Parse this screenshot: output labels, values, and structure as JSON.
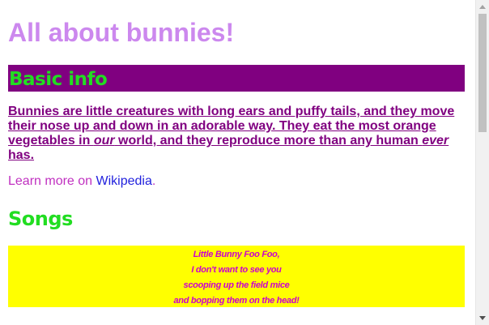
{
  "page": {
    "title": "All about bunnies!"
  },
  "basic_info": {
    "heading": "Basic info",
    "intro_part1": "Bunnies are little creatures with long ears and puffy tails, and they move their nose up and down in an adorable way. They eat the most orange vegetables in ",
    "intro_em1": "our",
    "intro_part2": " world, and they reproduce more than any human ",
    "intro_em2": "ever",
    "intro_part3": " has.",
    "learn_more_prefix": "Learn more on ",
    "learn_more_link": "Wikipedia",
    "learn_more_suffix": "."
  },
  "songs": {
    "heading": "Songs",
    "lines": [
      "Little Bunny Foo Foo,",
      "I don't want to see you",
      "scooping up the field mice",
      "and bopping them on the head!"
    ]
  },
  "colors": {
    "title": "#cc88ee",
    "heading_bar": "#800080",
    "heading_text": "#22dd22",
    "body_text": "#800080",
    "link": "#2222dd",
    "song_bg": "#ffff00",
    "song_text": "#cc00cc"
  }
}
